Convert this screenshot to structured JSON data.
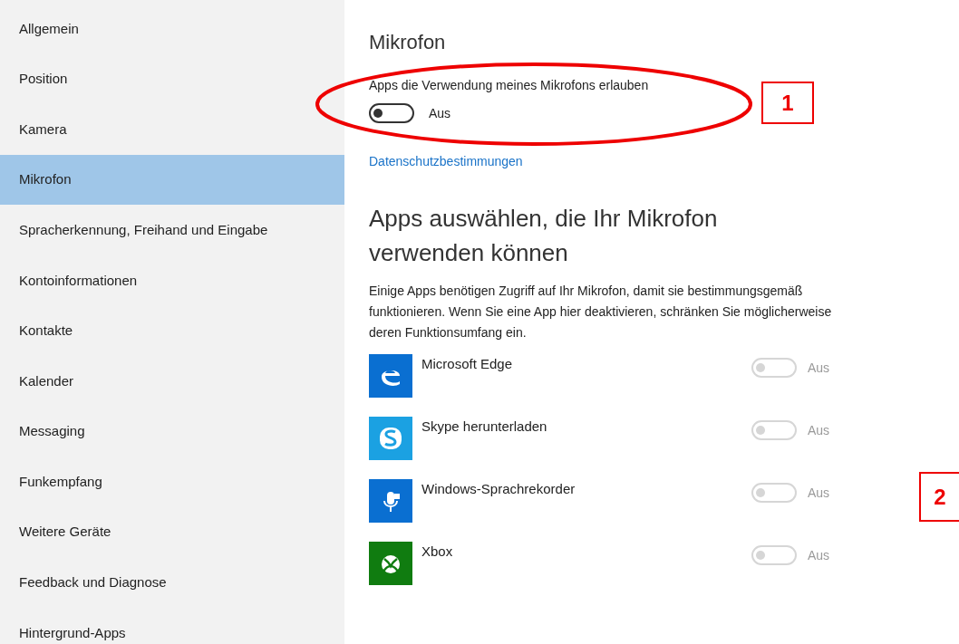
{
  "sidebar": {
    "items": [
      {
        "label": "Allgemein",
        "selected": false
      },
      {
        "label": "Position",
        "selected": false
      },
      {
        "label": "Kamera",
        "selected": false
      },
      {
        "label": "Mikrofon",
        "selected": true
      },
      {
        "label": "Spracherkennung, Freihand und Eingabe",
        "selected": false
      },
      {
        "label": "Kontoinformationen",
        "selected": false
      },
      {
        "label": "Kontakte",
        "selected": false
      },
      {
        "label": "Kalender",
        "selected": false
      },
      {
        "label": "Messaging",
        "selected": false
      },
      {
        "label": "Funkempfang",
        "selected": false
      },
      {
        "label": "Weitere Geräte",
        "selected": false
      },
      {
        "label": "Feedback und Diagnose",
        "selected": false
      },
      {
        "label": "Hintergrund-Apps",
        "selected": false
      }
    ]
  },
  "main": {
    "title": "Mikrofon",
    "master_toggle": {
      "label": "Apps die Verwendung meines Mikrofons erlauben",
      "on": false,
      "state_text": "Aus"
    },
    "privacy_link": "Datenschutzbestimmungen",
    "section_heading": "Apps auswählen, die Ihr Mikrofon verwenden können",
    "description": "Einige Apps benötigen Zugriff auf Ihr Mikrofon, damit sie bestimmungsgemäß funktionieren. Wenn Sie eine App hier deaktivieren, schränken Sie möglicherweise deren Funktionsumfang ein.",
    "apps": [
      {
        "name": "Microsoft Edge",
        "kind": "edge",
        "color": "#0a6fd1",
        "on": false,
        "disabled": true,
        "state_text": "Aus"
      },
      {
        "name": "Skype herunterladen",
        "kind": "skype",
        "color": "#1ba1e2",
        "on": false,
        "disabled": true,
        "state_text": "Aus"
      },
      {
        "name": "Windows-Sprachrekorder",
        "kind": "recorder",
        "color": "#0a6fd1",
        "on": false,
        "disabled": true,
        "state_text": "Aus"
      },
      {
        "name": "Xbox",
        "kind": "xbox",
        "color": "#107c10",
        "on": false,
        "disabled": true,
        "state_text": "Aus"
      }
    ]
  },
  "callouts": [
    {
      "label": "1"
    },
    {
      "label": "2"
    }
  ]
}
